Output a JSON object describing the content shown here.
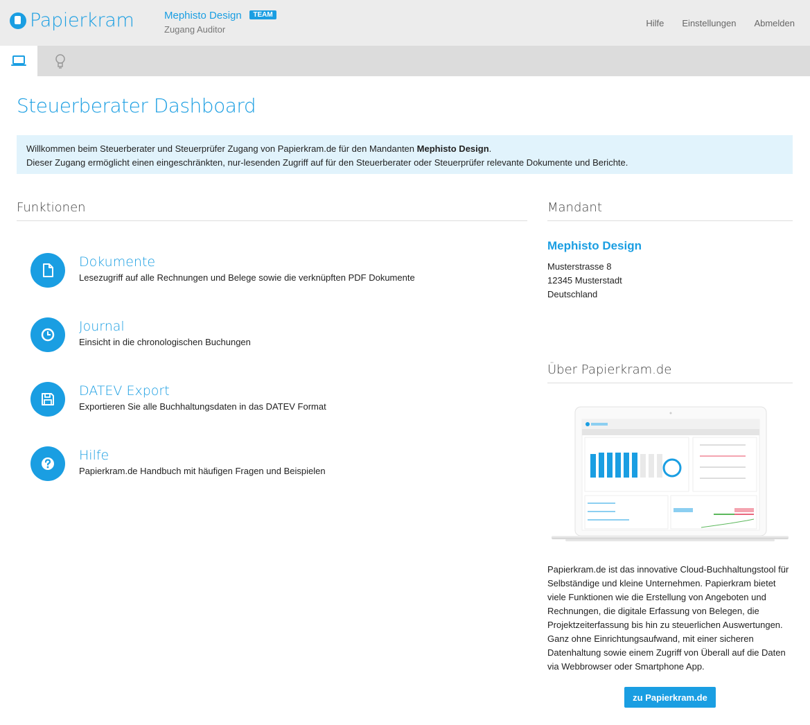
{
  "header": {
    "logo_text": "Papierkram",
    "account_name": "Mephisto Design",
    "badge": "TEAM",
    "account_role": "Zugang Auditor",
    "nav": [
      "Hilfe",
      "Einstellungen",
      "Abmelden"
    ]
  },
  "tabs": [
    {
      "icon": "laptop-icon",
      "active": true
    },
    {
      "icon": "lightbulb-icon",
      "active": false
    }
  ],
  "page_title": "Steuerberater Dashboard",
  "welcome": {
    "line1_prefix": "Willkommen beim Steuerberater und Steuerprüfer Zugang von Papierkram.de für den Mandanten ",
    "line1_client": "Mephisto Design",
    "line1_suffix": ".",
    "line2": "Dieser Zugang ermöglicht einen eingeschränkten, nur-lesenden Zugriff auf für den Steuerberater oder Steuerprüfer relevante Dokumente und Berichte."
  },
  "funktionen": {
    "heading": "Funktionen",
    "items": [
      {
        "title": "Dokumente",
        "desc": "Lesezugriff auf alle Rechnungen und Belege sowie die verknüpften PDF Dokumente",
        "icon": "document-icon"
      },
      {
        "title": "Journal",
        "desc": "Einsicht in die chronologischen Buchungen",
        "icon": "clock-icon"
      },
      {
        "title": "DATEV Export",
        "desc": "Exportieren Sie alle Buchhaltungsdaten in das DATEV Format",
        "icon": "floppy-disk-icon"
      },
      {
        "title": "Hilfe",
        "desc": "Papierkram.de Handbuch mit häufigen Fragen und Beispielen",
        "icon": "question-icon"
      }
    ]
  },
  "mandant": {
    "heading": "Mandant",
    "name": "Mephisto Design",
    "street": "Musterstrasse 8",
    "city": "12345 Musterstadt",
    "country": "Deutschland"
  },
  "about": {
    "heading": "Über Papierkram.de",
    "text": "Papierkram.de ist das innovative Cloud-Buchhaltungstool für Selbständige und kleine Unternehmen. Papierkram bietet viele Funktionen wie die Erstellung von Angeboten und Rechnungen, die digitale Erfassung von Belegen, die Projektzeiterfassung bis hin zu steuerlichen Auswertungen. Ganz ohne Einrichtungsaufwand, mit einer sicheren Datenhaltung sowie einem Zugriff von Überall auf die Daten via Webbrowser oder Smartphone App.",
    "button": "zu Papierkram.de"
  },
  "colors": {
    "accent": "#1a9ee2",
    "info_bg": "#e1f3fc"
  }
}
